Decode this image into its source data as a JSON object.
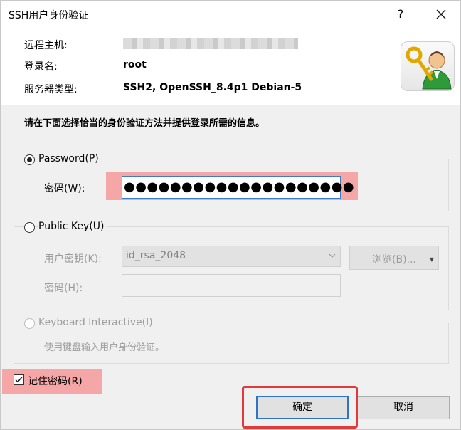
{
  "window": {
    "title": "SSH用户身份验证",
    "help_label": "?",
    "close_icon": "close-icon"
  },
  "info": {
    "remote_host_label": "远程主机:",
    "remote_host_value": "",
    "login_name_label": "登录名:",
    "login_name_value": "root",
    "server_type_label": "服务器类型:",
    "server_type_value": "SSH2, OpenSSH_8.4p1 Debian-5",
    "logo_icon": "key-user-icon"
  },
  "instruction": "请在下面选择恰当的身份验证方法并提供登录所需的信息。",
  "password_group": {
    "title": "Password(P)",
    "selected": true,
    "field_label": "密码(W):",
    "field_value": "●●●●●●●●●●●●●●●●●●●●"
  },
  "publickey_group": {
    "title": "Public Key(U)",
    "selected": false,
    "user_key_label": "用户密钥(K):",
    "user_key_value": "id_rsa_2048",
    "browse_label": "浏览(B)...",
    "passphrase_label": "密码(H):",
    "passphrase_value": ""
  },
  "keyboard_group": {
    "title": "Keyboard Interactive(I)",
    "enabled": false,
    "description": "使用键盘输入用户身份验证。"
  },
  "remember_password": {
    "label": "记住密码(R)",
    "checked": true
  },
  "buttons": {
    "ok_label": "确定",
    "cancel_label": "取消"
  },
  "colors": {
    "highlight": "#f5a6a6",
    "focus_border": "#2f73c8",
    "annotation_red": "#e23a3a"
  }
}
